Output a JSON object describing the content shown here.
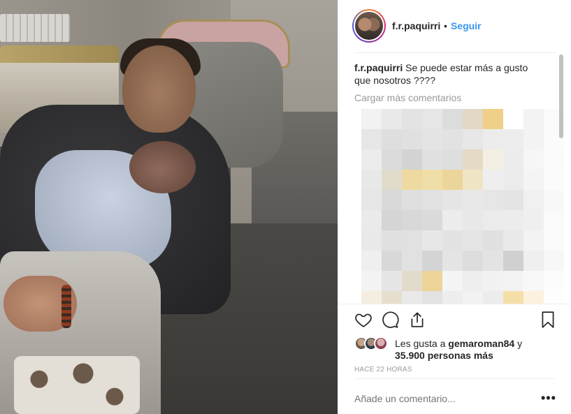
{
  "photo": {
    "icon": "post-photo"
  },
  "header": {
    "username": "f.r.paquirri",
    "separator": "•",
    "follow_label": "Seguir"
  },
  "caption": {
    "username": "f.r.paquirri",
    "text": "Se puede estar más a gusto que nosotros ????"
  },
  "load_more_label": "Cargar más comentarios",
  "pixelated_colors": [
    [
      "#f2f2f2",
      "#e9e9e9",
      "#e3e3e3",
      "#e6e6e6",
      "#dcdcdc",
      "#e3d8c5",
      "#f0d088",
      "#ffffff",
      "#f3f3f3",
      "#fafafa"
    ],
    [
      "#e6e6e6",
      "#dedede",
      "#e0e0e0",
      "#e4e4e4",
      "#e2e2e2",
      "#e7e7e7",
      "#ececec",
      "#ededed",
      "#f3f3f3",
      "#fbfbfb"
    ],
    [
      "#ececec",
      "#dbdbdb",
      "#d3d3d3",
      "#e0e0e0",
      "#dedede",
      "#e5dac6",
      "#f4efe3",
      "#ececec",
      "#f6f6f6",
      "#fafafa"
    ],
    [
      "#e8e8e8",
      "#e1dbcc",
      "#eed9a0",
      "#f0dea9",
      "#ecd59b",
      "#efe4c4",
      "#eeeeee",
      "#ebebeb",
      "#f4f4f4",
      "#fbfbfb"
    ],
    [
      "#e6e6e6",
      "#d9d9d9",
      "#dfdfdf",
      "#e1e1e1",
      "#e5e5e5",
      "#e8e8e8",
      "#e6e6e6",
      "#e4e4e4",
      "#f0f0f0",
      "#f8f8f8"
    ],
    [
      "#eaeaea",
      "#d5d5d5",
      "#d8d8d8",
      "#dadada",
      "#ececec",
      "#e8e8e8",
      "#ebebeb",
      "#ececec",
      "#efefef",
      "#fafafa"
    ],
    [
      "#e9e9e9",
      "#e0e0e0",
      "#e1e1e1",
      "#e7e7e7",
      "#e2e2e2",
      "#e5e5e5",
      "#e0e0e0",
      "#e9e9e9",
      "#f3f3f3",
      "#fafafa"
    ],
    [
      "#efefef",
      "#d8d8d8",
      "#e1e1e1",
      "#d4d4d4",
      "#e4e4e4",
      "#dcdcdc",
      "#e3e3e3",
      "#d0d0d0",
      "#efefef",
      "#f7f7f7"
    ],
    [
      "#f3f3f3",
      "#e5e5e5",
      "#e3dbc9",
      "#efd49a",
      "#f4f4f4",
      "#eeeeee",
      "#f1f1f1",
      "#f3f3f3",
      "#f8f8f8",
      "#fcfcfc"
    ],
    [
      "#f5eee0",
      "#e6dfcd",
      "#e9e9e9",
      "#e2e2e2",
      "#ededed",
      "#f2f2f2",
      "#ececec",
      "#f5dfa8",
      "#fbf1dd",
      "#fdfdfd"
    ]
  ],
  "actions": {
    "like_icon": "heart-icon",
    "comment_icon": "comment-icon",
    "share_icon": "share-icon",
    "save_icon": "bookmark-icon"
  },
  "likes": {
    "prefix": "Les gusta a",
    "user": "gemaroman84",
    "conjunction": "y",
    "count_text": "35.900 personas más"
  },
  "timestamp": "HACE 22 HORAS",
  "add_comment_placeholder": "Añade un comentario...",
  "more_options_label": "•••"
}
